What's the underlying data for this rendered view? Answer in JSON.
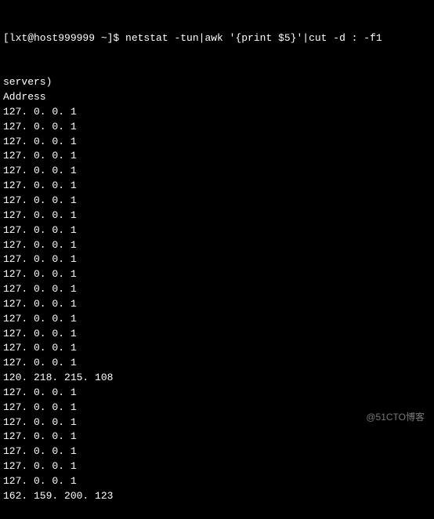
{
  "terminal": {
    "top_partial_line": "162. 159. 200. 123",
    "top_line_visible": false,
    "prompt": "[lxt@host999999 ~]$ ",
    "command": "netstat -tun|awk '{print $5}'|cut -d : -f1",
    "lines": [
      "servers)",
      "Address",
      "127. 0. 0. 1",
      "127. 0. 0. 1",
      "127. 0. 0. 1",
      "127. 0. 0. 1",
      "127. 0. 0. 1",
      "127. 0. 0. 1",
      "127. 0. 0. 1",
      "127. 0. 0. 1",
      "127. 0. 0. 1",
      "127. 0. 0. 1",
      "127. 0. 0. 1",
      "127. 0. 0. 1",
      "127. 0. 0. 1",
      "127. 0. 0. 1",
      "127. 0. 0. 1",
      "127. 0. 0. 1",
      "127. 0. 0. 1",
      "127. 0. 0. 1",
      "120. 218. 215. 108",
      "127. 0. 0. 1",
      "127. 0. 0. 1",
      "127. 0. 0. 1",
      "127. 0. 0. 1",
      "127. 0. 0. 1",
      "127. 0. 0. 1",
      "127. 0. 0. 1",
      "162. 159. 200. 123"
    ]
  },
  "watermark": "@51CTO博客"
}
